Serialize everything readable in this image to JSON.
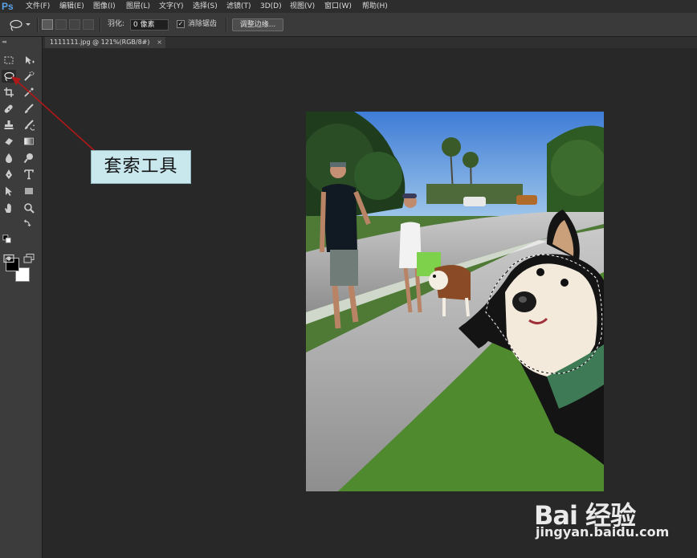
{
  "app": {
    "logo": "Ps"
  },
  "menu": [
    "文件(F)",
    "编辑(E)",
    "图像(I)",
    "图层(L)",
    "文字(Y)",
    "选择(S)",
    "滤镜(T)",
    "3D(D)",
    "视图(V)",
    "窗口(W)",
    "帮助(H)"
  ],
  "options": {
    "feather_label": "羽化:",
    "feather_value": "0 像素",
    "antialias_label": "消除锯齿",
    "antialias_checked": true,
    "refine_edge_label": "调整边缘..."
  },
  "document": {
    "tab_title": "1111111.jpg @ 121%(RGB/8#)",
    "tab_close": "×"
  },
  "toolbox": {
    "grip": "◂◂",
    "tools": [
      "rectangular-marquee-icon",
      "move-icon",
      "lasso-icon",
      "quick-selection-icon",
      "crop-icon",
      "eyedropper-icon",
      "spot-healing-icon",
      "brush-icon",
      "clone-stamp-icon",
      "history-brush-icon",
      "eraser-icon",
      "gradient-icon",
      "blur-icon",
      "dodge-icon",
      "pen-icon",
      "type-icon",
      "path-selection-icon",
      "rectangle-shape-icon",
      "hand-icon",
      "zoom-icon"
    ],
    "active_tool": "lasso-icon",
    "foreground_color": "#000000",
    "background_color": "#ffffff"
  },
  "annotation": {
    "text": "套索工具"
  },
  "watermark": {
    "logo": "Bai 经验",
    "url": "jingyan.baidu.com"
  },
  "colors": {
    "accent": "#5aa3e6",
    "arrow": "#b01818",
    "callout_bg": "#c8e8ee"
  }
}
